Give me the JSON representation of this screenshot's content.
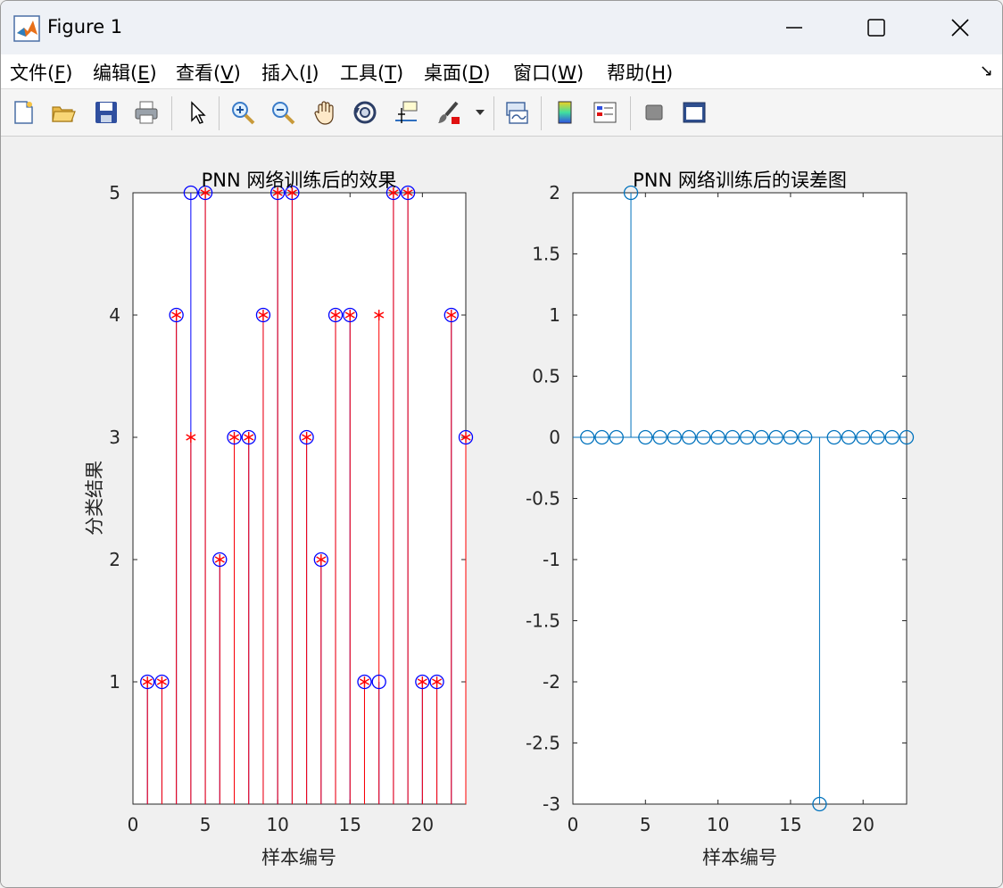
{
  "window": {
    "title": "Figure 1",
    "controls": {
      "minimize": "minimize",
      "maximize": "maximize",
      "close": "close"
    }
  },
  "menu": {
    "items": [
      {
        "label": "文件(",
        "acc": "F",
        "end": ")"
      },
      {
        "label": "编辑(",
        "acc": "E",
        "end": ")"
      },
      {
        "label": "查看(",
        "acc": "V",
        "end": ")"
      },
      {
        "label": "插入(",
        "acc": "I",
        "end": ")"
      },
      {
        "label": "工具(",
        "acc": "T",
        "end": ")"
      },
      {
        "label": "桌面(",
        "acc": "D",
        "end": ")"
      },
      {
        "label": "窗口(",
        "acc": "W",
        "end": ")"
      },
      {
        "label": "帮助(",
        "acc": "H",
        "end": ")"
      }
    ],
    "dock_arrow": "↘"
  },
  "toolbar": {
    "icons": [
      "new-figure-icon",
      "open-file-icon",
      "save-icon",
      "print-icon",
      "pointer-arrow-icon",
      "zoom-in-icon",
      "zoom-out-icon",
      "pan-hand-icon",
      "rotate-3d-icon",
      "data-cursor-icon",
      "brush-icon",
      "dropdown-arrow-icon",
      "link-plot-icon",
      "colorbar-icon",
      "legend-icon",
      "hide-plot-tools-icon",
      "show-plot-tools-icon"
    ]
  },
  "colors": {
    "blue": "#0000ff",
    "red": "#ff0000",
    "matlab_blue": "#0072bd"
  },
  "chart_data": [
    {
      "type": "stem",
      "title": "PNN 网络训练后的效果",
      "xlabel": "样本编号",
      "ylabel": "分类结果",
      "xlim": [
        0,
        23
      ],
      "ylim": [
        0,
        5
      ],
      "xticks": [
        0,
        5,
        10,
        15,
        20
      ],
      "yticks": [
        1,
        2,
        3,
        4,
        5
      ],
      "x": [
        1,
        2,
        3,
        4,
        5,
        6,
        7,
        8,
        9,
        10,
        11,
        12,
        13,
        14,
        15,
        16,
        17,
        18,
        19,
        20,
        21,
        22,
        23
      ],
      "series": [
        {
          "marker": "o",
          "color": "blue",
          "values": [
            1,
            1,
            4,
            5,
            5,
            2,
            3,
            3,
            4,
            5,
            5,
            3,
            2,
            4,
            4,
            1,
            1,
            5,
            5,
            1,
            1,
            4,
            3
          ]
        },
        {
          "marker": "*",
          "color": "red",
          "values": [
            1,
            1,
            4,
            3,
            5,
            2,
            3,
            3,
            4,
            5,
            5,
            3,
            2,
            4,
            4,
            1,
            4,
            5,
            5,
            1,
            1,
            4,
            3
          ]
        }
      ]
    },
    {
      "type": "stem",
      "title": "PNN 网络训练后的误差图",
      "xlabel": "样本编号",
      "ylabel": "",
      "xlim": [
        0,
        23
      ],
      "ylim": [
        -3,
        2
      ],
      "xticks": [
        0,
        5,
        10,
        15,
        20
      ],
      "yticks": [
        -3,
        -2.5,
        -2,
        -1.5,
        -1,
        -0.5,
        0,
        0.5,
        1,
        1.5,
        2
      ],
      "ytick_labels": [
        "-3",
        "-2.5",
        "-2",
        "-1.5",
        "-1",
        "-0.5",
        "0",
        "0.5",
        "1",
        "1.5",
        "2"
      ],
      "x": [
        1,
        2,
        3,
        4,
        5,
        6,
        7,
        8,
        9,
        10,
        11,
        12,
        13,
        14,
        15,
        16,
        17,
        18,
        19,
        20,
        21,
        22,
        23
      ],
      "series": [
        {
          "marker": "o",
          "color": "matlab_blue",
          "values": [
            0,
            0,
            0,
            2,
            0,
            0,
            0,
            0,
            0,
            0,
            0,
            0,
            0,
            0,
            0,
            0,
            -3,
            0,
            0,
            0,
            0,
            0,
            0
          ]
        }
      ]
    }
  ]
}
